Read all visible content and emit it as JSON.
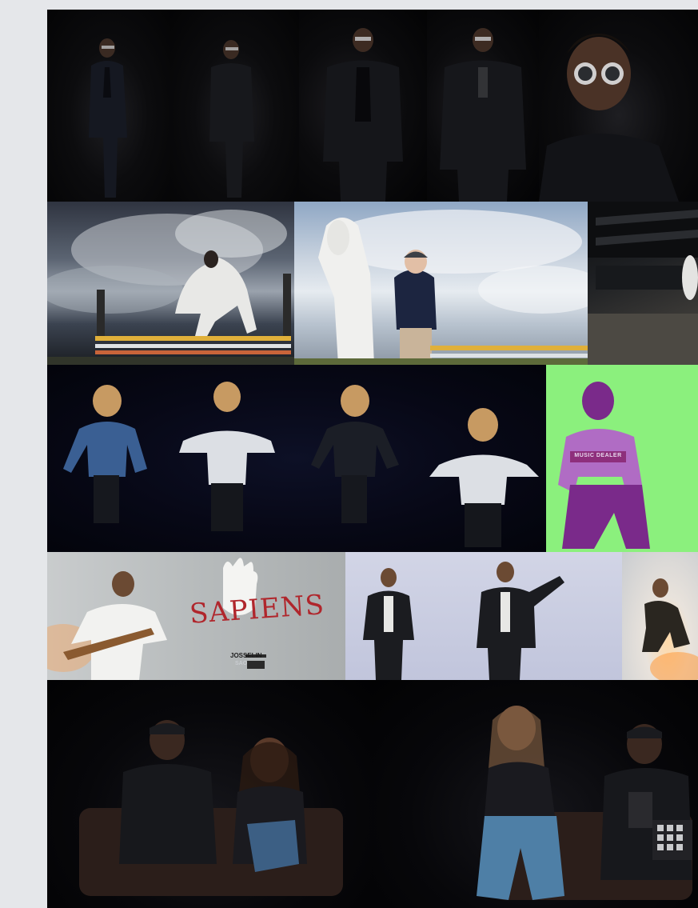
{
  "gallery": {
    "rows": [
      {
        "name": "portrait-series-men-in-suit",
        "tiles": [
          {
            "id": "suit-portrait-1",
            "subject": "man in dark suit, full body"
          },
          {
            "id": "suit-portrait-2",
            "subject": "man in dark suit, full body"
          },
          {
            "id": "suit-portrait-3",
            "subject": "man in dark suit, three-quarter"
          },
          {
            "id": "suit-portrait-4",
            "subject": "man in dark suit, three-quarter"
          },
          {
            "id": "suit-portrait-5",
            "subject": "man with sunglasses, close-up"
          }
        ]
      },
      {
        "name": "equestrian-series",
        "tiles": [
          {
            "id": "horse-jump",
            "subject": "rider jumping obstacle under stormy sky"
          },
          {
            "id": "horse-and-rider",
            "subject": "woman with white horse"
          },
          {
            "id": "horse-arena",
            "subject": "horse in dark indoor arena"
          }
        ]
      },
      {
        "name": "kids-jumping-series",
        "tiles": [
          {
            "id": "kids-jump",
            "subject": "children jumping, four poses"
          },
          {
            "id": "green-portrait",
            "subject": "man crouching, duotone green/purple"
          }
        ]
      },
      {
        "name": "sapiens-series",
        "tiles": [
          {
            "id": "sapiens-cover",
            "subject": "man with guitar, Sapiens logo"
          },
          {
            "id": "leather-jacket-1",
            "subject": "man in leather jacket"
          },
          {
            "id": "leather-jacket-2",
            "subject": "man in leather jacket pointing"
          },
          {
            "id": "crouching-fire",
            "subject": "man crouching with sparks"
          }
        ]
      },
      {
        "name": "duo-series",
        "tiles": [
          {
            "id": "duo-sofa-1",
            "subject": "couple seated on sofa"
          },
          {
            "id": "duo-sofa-2",
            "subject": "couple seated with drum machine"
          }
        ]
      }
    ]
  },
  "sapiens_logo": {
    "text": "SAPIENS",
    "caption": "JOSSELIN",
    "caption_tag": "SAO"
  },
  "green_portrait_tshirt": "MUSIC DEALER",
  "colors": {
    "page_bg": "#e5e7ea",
    "logo_red": "#b0262c",
    "duotone_green": "#8bf07d",
    "duotone_purple": "#7a2a8a"
  }
}
